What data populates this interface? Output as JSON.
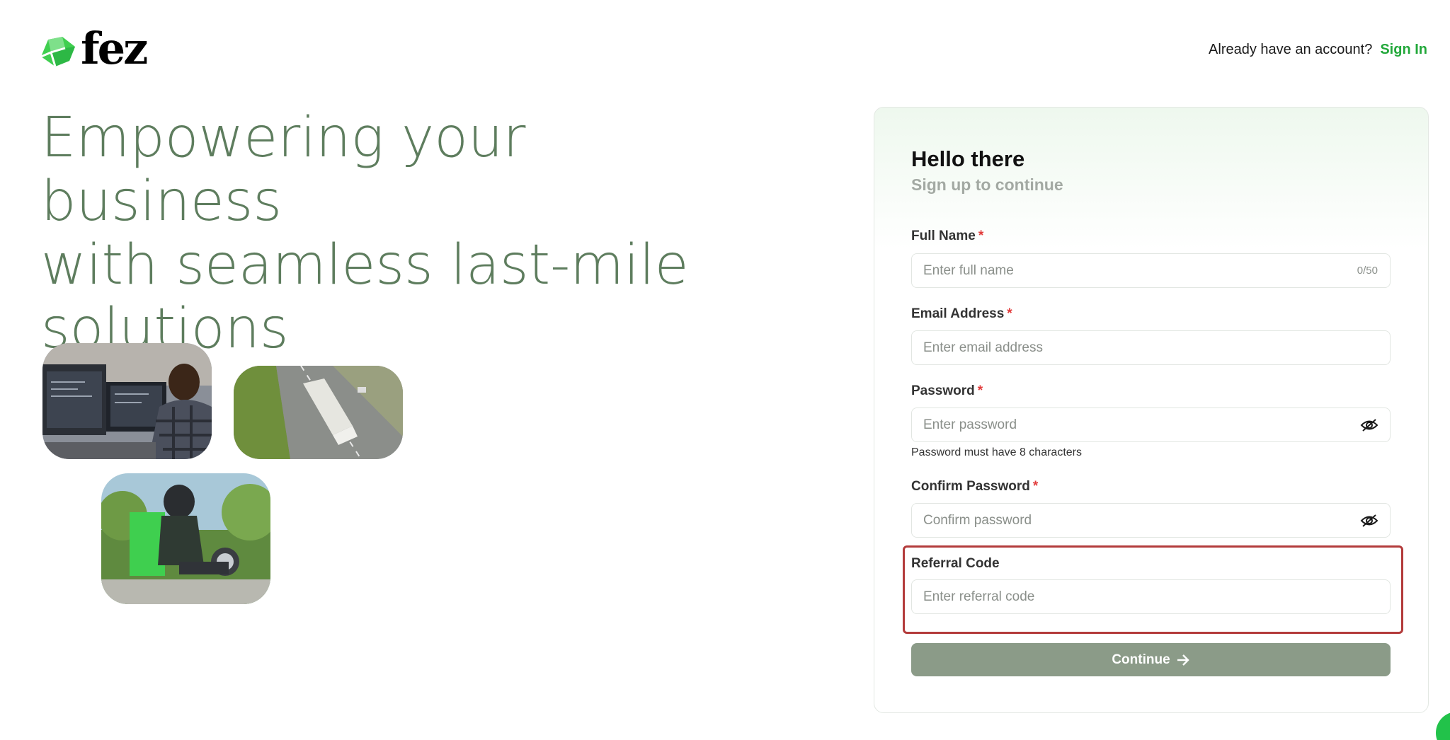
{
  "brand": {
    "name": "fez",
    "accent": "#22a83a",
    "logo_color": "#3fcf4f"
  },
  "header": {
    "prompt": "Already have an account?",
    "signin_label": "Sign In"
  },
  "hero": {
    "lines": [
      "Empowering your business",
      "with seamless last-mile",
      "solutions"
    ],
    "color": "#5e7d5e"
  },
  "photos": [
    {
      "name": "developer-at-monitors-photo"
    },
    {
      "name": "truck-on-highway-photo"
    },
    {
      "name": "delivery-rider-motorcycle-photo"
    }
  ],
  "form": {
    "title": "Hello there",
    "subtitle": "Sign up to continue",
    "full_name": {
      "label": "Full Name",
      "required": "*",
      "placeholder": "Enter full name",
      "value": "",
      "counter": "0/50"
    },
    "email": {
      "label": "Email Address",
      "required": "*",
      "placeholder": "Enter email address",
      "value": ""
    },
    "password": {
      "label": "Password",
      "required": "*",
      "placeholder": "Enter password",
      "value": "",
      "hint": "Password must have 8 characters"
    },
    "confirm_password": {
      "label": "Confirm Password",
      "required": "*",
      "placeholder": "Confirm password",
      "value": ""
    },
    "referral": {
      "label": "Referral Code",
      "placeholder": "Enter referral code",
      "value": ""
    },
    "continue_label": "Continue",
    "continue_color": "#8b9b88"
  },
  "icons": {
    "password_toggle": "eye-slash-icon",
    "continue_arrow": "arrow-right-icon",
    "chat": "chat-widget-icon"
  }
}
